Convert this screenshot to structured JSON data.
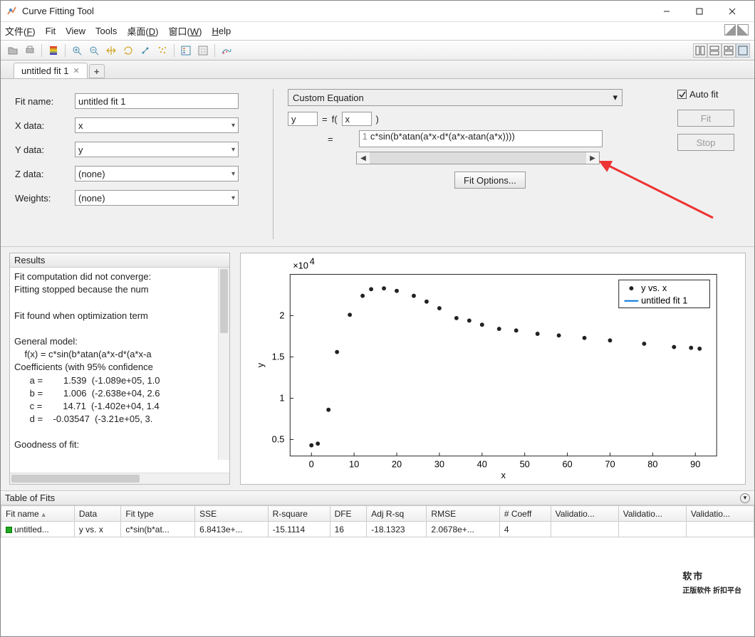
{
  "window": {
    "title": "Curve Fitting Tool"
  },
  "menu": {
    "file": "文件(F)",
    "fit": "Fit",
    "view": "View",
    "tools": "Tools",
    "desktop": "桌面(D)",
    "window": "窗口(W)",
    "help": "Help"
  },
  "tab": {
    "name": "untitled fit 1"
  },
  "form": {
    "fitname_label": "Fit name:",
    "fitname_value": "untitled fit 1",
    "xdata_label": "X data:",
    "xdata_value": "x",
    "ydata_label": "Y data:",
    "ydata_value": "y",
    "zdata_label": "Z data:",
    "zdata_value": "(none)",
    "weights_label": "Weights:",
    "weights_value": "(none)"
  },
  "equation": {
    "type": "Custom Equation",
    "y_var": "y",
    "eq_sym": "=",
    "f": "f(",
    "x_var": "x",
    "close": ")",
    "eq_sym2": "=",
    "formula_prefix": "1",
    "formula": "c*sin(b*atan(a*x-d*(a*x-atan(a*x))))",
    "fit_options": "Fit Options..."
  },
  "right": {
    "autofit": "Auto fit",
    "fit": "Fit",
    "stop": "Stop"
  },
  "results": {
    "header": "Results",
    "lines": [
      "Fit computation did not converge:",
      "Fitting stopped because the num",
      "",
      "Fit found when optimization term",
      "",
      "General model:",
      "    f(x) = c*sin(b*atan(a*x-d*(a*x-a",
      "Coefficients (with 95% confidence",
      "      a =        1.539  (-1.089e+05, 1.0",
      "      b =        1.006  (-2.638e+04, 2.6",
      "      c =        14.71  (-1.402e+04, 1.4",
      "      d =    -0.03547  (-3.21e+05, 3.",
      "",
      "Goodness of fit:"
    ]
  },
  "chart_data": {
    "type": "scatter",
    "xlabel": "x",
    "ylabel": "y",
    "exponent": "×10",
    "exponent_sup": "4",
    "yticks": [
      0.5,
      1,
      1.5,
      2
    ],
    "xticks": [
      0,
      10,
      20,
      30,
      40,
      50,
      60,
      70,
      80,
      90
    ],
    "ylim": [
      0.3,
      2.5
    ],
    "xlim": [
      -5,
      95
    ],
    "legend": [
      {
        "marker": "dot",
        "label": "y vs. x"
      },
      {
        "marker": "line",
        "label": "untitled fit 1"
      }
    ],
    "series": [
      {
        "name": "y vs. x",
        "x": [
          0,
          1.5,
          4,
          6,
          9,
          12,
          14,
          17,
          20,
          24,
          27,
          30,
          34,
          37,
          40,
          44,
          48,
          53,
          58,
          64,
          70,
          78,
          85,
          89,
          91
        ],
        "y": [
          0.43,
          0.45,
          0.86,
          1.56,
          2.01,
          2.24,
          2.32,
          2.33,
          2.3,
          2.24,
          2.17,
          2.09,
          1.97,
          1.94,
          1.89,
          1.84,
          1.82,
          1.78,
          1.76,
          1.73,
          1.7,
          1.66,
          1.62,
          1.61,
          1.6
        ]
      }
    ]
  },
  "tablefits": {
    "header": "Table of Fits",
    "cols": [
      "Fit name",
      "Data",
      "Fit type",
      "SSE",
      "R-square",
      "DFE",
      "Adj R-sq",
      "RMSE",
      "# Coeff",
      "Validatio...",
      "Validatio...",
      "Validatio..."
    ],
    "row": {
      "fitname": "untitled...",
      "data": "y vs. x",
      "fittype": "c*sin(b*at...",
      "sse": "6.8413e+...",
      "rsq": "-15.1114",
      "dfe": "16",
      "adjrsq": "-18.1323",
      "rmse": "2.0678e+...",
      "ncoeff": "4",
      "v1": "",
      "v2": "",
      "v3": ""
    }
  },
  "watermark": {
    "main": "软市",
    "sub": "正版软件\n折扣平台"
  }
}
